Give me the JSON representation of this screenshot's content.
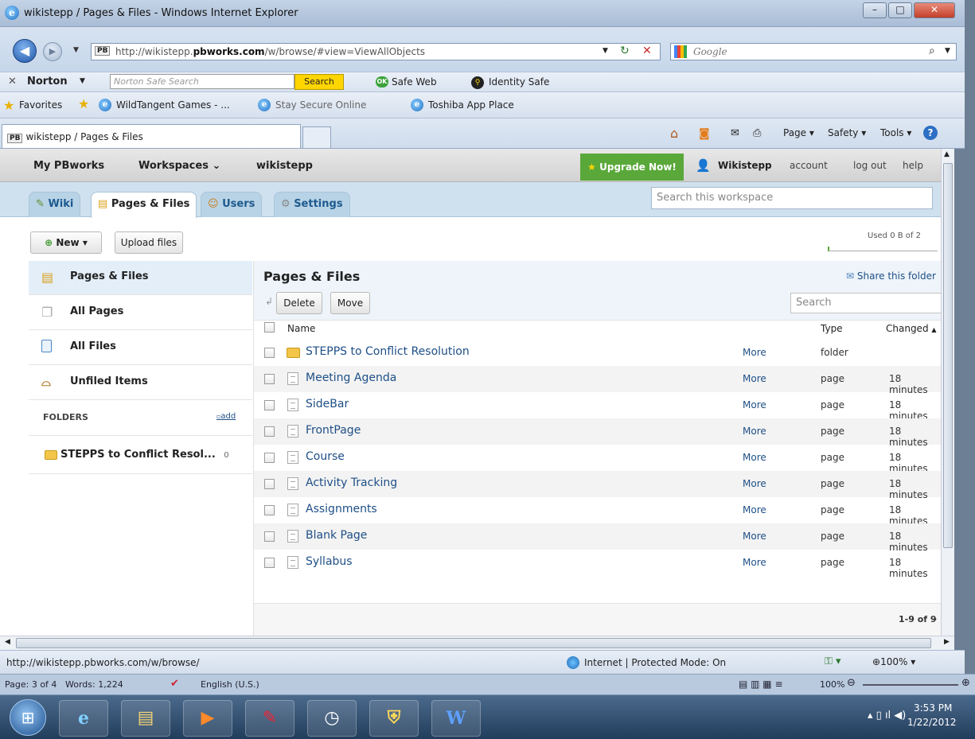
{
  "browser": {
    "window_title": "wikistepp / Pages & Files - Windows Internet Explorer",
    "address_prefix": "http://wikistepp.",
    "address_domain": "pbworks.com",
    "address_suffix": "/w/browse/#view=ViewAllObjects",
    "search_engine": "Google",
    "tab_title": "wikistepp / Pages & Files",
    "status_url": "http://wikistepp.pbworks.com/w/browse/",
    "zone": "Internet | Protected Mode: On",
    "zoom": "100%"
  },
  "norton": {
    "brand": "Norton",
    "search_placeholder": "Norton Safe Search",
    "search_btn": "Search",
    "safe_web": "Safe Web",
    "identity_safe": "Identity Safe"
  },
  "favorites": {
    "label": "Favorites",
    "items": [
      "WildTangent Games - ...",
      "Stay Secure Online",
      "Toshiba App Place"
    ]
  },
  "commandbar": {
    "page": "Page",
    "safety": "Safety",
    "tools": "Tools"
  },
  "pbworks": {
    "nav": {
      "home": "My PBworks",
      "workspaces": "Workspaces",
      "current": "wikistepp"
    },
    "upgrade": "Upgrade Now!",
    "user": "Wikistepp",
    "account": "account",
    "logout": "log out",
    "help": "help",
    "tabs": [
      "Wiki",
      "Pages & Files",
      "Users",
      "Settings"
    ],
    "workspace_search_placeholder": "Search this workspace",
    "new_btn": "New",
    "upload_btn": "Upload files",
    "usage": "Used 0 B of 2",
    "sidebar": [
      {
        "label": "Pages & Files",
        "icon": "pages-files-icon"
      },
      {
        "label": "All Pages",
        "icon": "pages-icon"
      },
      {
        "label": "All Files",
        "icon": "file-icon"
      },
      {
        "label": "Unfiled Items",
        "icon": "inbox-icon"
      }
    ],
    "folders_header": "FOLDERS",
    "add_folder": "add",
    "folder_item": "STEPPS to Conflict Resol...",
    "folder_count": "0",
    "main_title": "Pages & Files",
    "share_folder": "Share this folder",
    "delete_btn": "Delete",
    "move_btn": "Move",
    "search_placeholder": "Search",
    "columns": {
      "name": "Name",
      "type": "Type",
      "changed": "Changed"
    },
    "rows": [
      {
        "name": "STEPPS to Conflict Resolution",
        "more": "More",
        "type": "folder",
        "changed": ""
      },
      {
        "name": "Meeting Agenda",
        "more": "More",
        "type": "page",
        "changed": "18 minutes"
      },
      {
        "name": "SideBar",
        "more": "More",
        "type": "page",
        "changed": "18 minutes"
      },
      {
        "name": "FrontPage",
        "more": "More",
        "type": "page",
        "changed": "18 minutes"
      },
      {
        "name": "Course",
        "more": "More",
        "type": "page",
        "changed": "18 minutes"
      },
      {
        "name": "Activity Tracking",
        "more": "More",
        "type": "page",
        "changed": "18 minutes"
      },
      {
        "name": "Assignments",
        "more": "More",
        "type": "page",
        "changed": "18 minutes"
      },
      {
        "name": "Blank Page",
        "more": "More",
        "type": "page",
        "changed": "18 minutes"
      },
      {
        "name": "Syllabus",
        "more": "More",
        "type": "page",
        "changed": "18 minutes"
      }
    ],
    "pagination": "1-9 of 9"
  },
  "word_status": {
    "page": "Page: 3 of 4",
    "words": "Words: 1,224",
    "language": "English (U.S.)",
    "zoom": "100%"
  },
  "taskbar": {
    "time": "3:53 PM",
    "date": "1/22/2012"
  }
}
